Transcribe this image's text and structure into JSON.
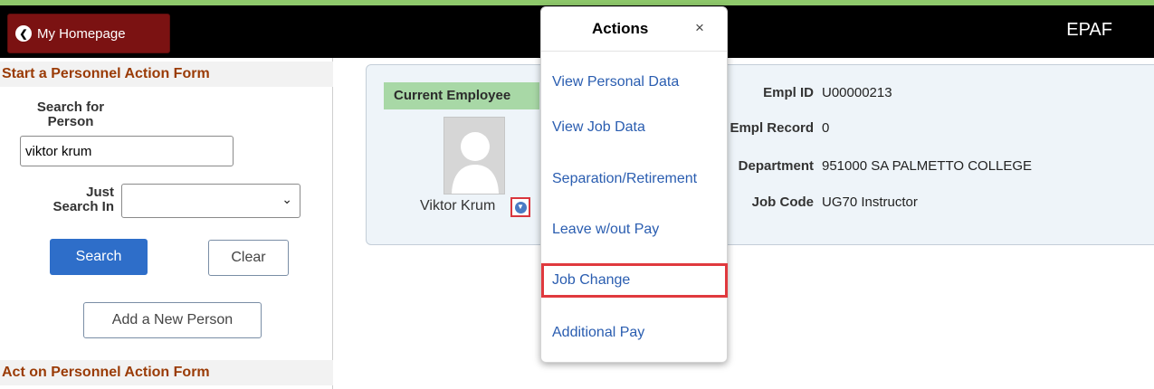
{
  "header": {
    "home_label": "My Homepage",
    "app_title": "EPAF"
  },
  "sidebar": {
    "start_title": "Start a Personnel Action Form",
    "search_for_label": "Search for\nPerson",
    "search_value": "viktor krum",
    "just_search_in_label": "Just\nSearch In",
    "just_search_in_value": "",
    "search_button": "Search",
    "clear_button": "Clear",
    "add_person_button": "Add a New Person",
    "act_title": "Act on Personnel Action Form"
  },
  "employee": {
    "badge": "Current Employee",
    "name": "Viktor Krum",
    "fields": [
      {
        "label": "Empl ID",
        "value": "U00000213"
      },
      {
        "label": "Empl Record",
        "value": "0"
      },
      {
        "label": "Department",
        "value": "951000  SA PALMETTO COLLEGE"
      },
      {
        "label": "Job Code",
        "value": "UG70  Instructor"
      }
    ]
  },
  "actions_popup": {
    "title": "Actions",
    "close": "×",
    "items": [
      "View Personal Data",
      "View Job Data",
      "Separation/Retirement",
      "Leave w/out Pay",
      "Job Change",
      "Additional Pay"
    ],
    "highlighted_item": "Job Change"
  },
  "colors": {
    "accent_dark_red": "#7b1212",
    "section_title": "#9a3b06",
    "primary_button": "#2e6ec9",
    "link": "#2a5db0",
    "badge": "#a8d8a6",
    "highlight_border": "#e0393e"
  }
}
